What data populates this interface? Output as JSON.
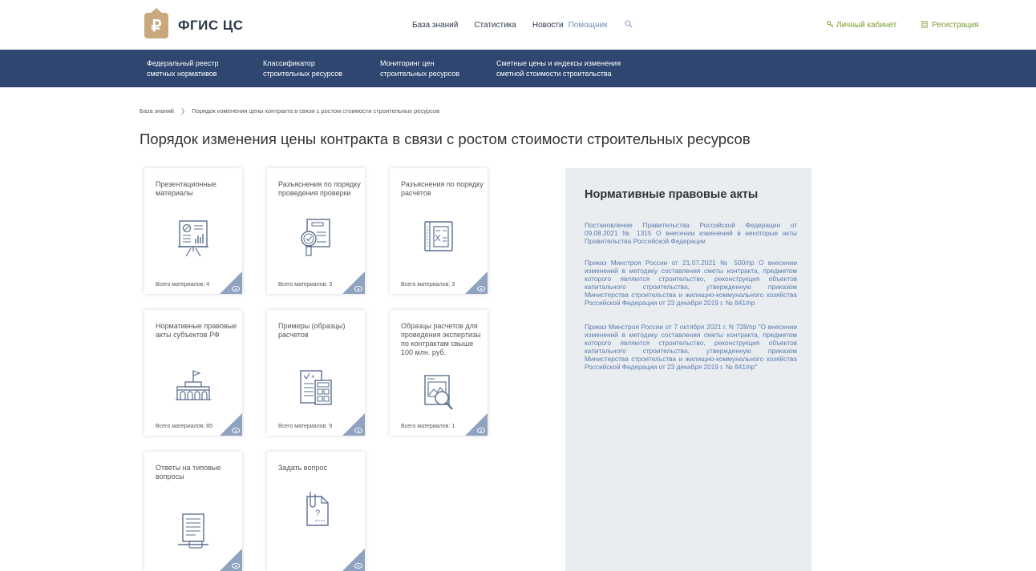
{
  "header": {
    "logo_glyph": "₽",
    "logo_text": "ФГИС ЦС",
    "nav": [
      "База знаний",
      "Статистика",
      "Новости"
    ],
    "helper_link": "Помощник",
    "search_icon": "search-icon",
    "account_label": "Личный кабинет",
    "register_label": "Регистрация",
    "brand_color": "#c8a87c",
    "accent_green": "#7a9a2e"
  },
  "band": {
    "background": "#2e4670",
    "items": [
      {
        "line1": "Федеральный реестр",
        "line2": "сметных нормативов"
      },
      {
        "line1": "Классификатор",
        "line2": "строительных ресурсов"
      },
      {
        "line1": "Мониторинг цен",
        "line2": "строительных ресурсов"
      },
      {
        "line1": "Сметные цены и индексы изменения",
        "line2": "сметной стоимости строительства"
      }
    ]
  },
  "breadcrumb": {
    "root": "База знаний",
    "current": "Порядок изменения цены контракта в связи с ростом стоимости строительных ресурсов"
  },
  "page_title": "Порядок изменения цены контракта в связи с ростом стоимости строительных ресурсов",
  "cards": [
    {
      "title": "Презентационные материалы",
      "count": "Всего материалов: 4",
      "icon": "presentation-board-icon"
    },
    {
      "title": "Разъяснения по порядку проведения проверки",
      "count": "Всего материалов: 3",
      "icon": "document-check-icon"
    },
    {
      "title": "Разъяснения по порядку расчетов",
      "count": "Всего материалов: 3",
      "icon": "calculation-book-icon"
    },
    {
      "title": "Нормативные правовые акты субъектов РФ",
      "count": "Всего материалов: 85",
      "icon": "government-building-icon"
    },
    {
      "title": "Примеры (образцы) расчетов",
      "count": "Всего материалов: 9",
      "icon": "calculator-document-icon"
    },
    {
      "title": "Образцы расчетов для проведения экспертизы по контрактам свыше 100 млн. руб.",
      "count": "Всего материалов: 1",
      "icon": "magnifier-document-icon"
    },
    {
      "title": "Ответы на типовые вопросы",
      "count": "",
      "icon": "answers-document-icon"
    },
    {
      "title": "Задать вопрос",
      "count": "",
      "icon": "question-document-icon"
    }
  ],
  "panel": {
    "title": "Нормативные правовые акты",
    "acts": [
      "Постановление Правительства Российской Федерации от 09.08.2021 № 1315 О внесении изменений в некоторые акты Правительства Российской Федерации",
      "Приказ Минстроя России от 21.07.2021 № 500/пр О внесении изменений в методику составления сметы контракта, предметом которого являются строительство, реконструкция объектов капитального строительства, утвержденную приказом Министерства строительства и жилищно-коммунального хозяйства Российской Федерации от 23 декабря 2019 г. № 841/пр",
      "Приказ Минстроя России от 7 октября 2021 г. N 728/пр \"О внесении изменений в методику составления сметы контракта, предметом которого являются строительство, реконструкция объектов капитального строительства, утвержденную приказом Министерства строительства и жилищно-коммунального хозяйства Российской Федерации от 23 декабря 2019 г. № 841/пр\""
    ],
    "background": "#e9edf0",
    "link_color": "#5c7ab0"
  }
}
